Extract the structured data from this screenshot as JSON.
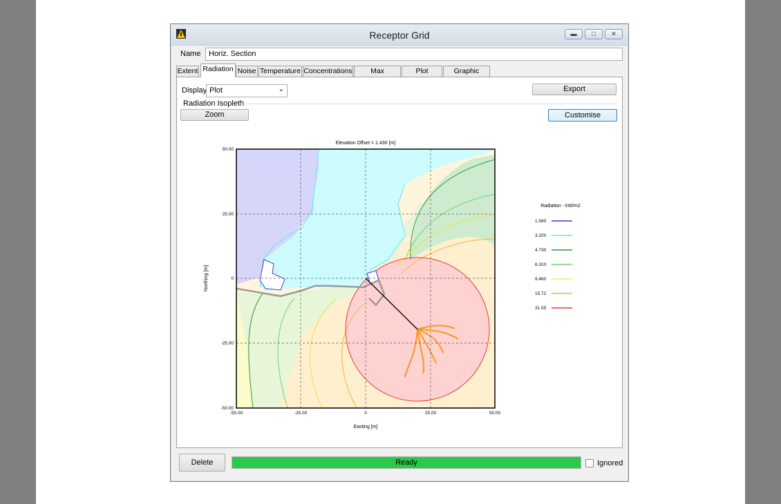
{
  "window": {
    "title": "Receptor Grid"
  },
  "name_field": {
    "label": "Name",
    "value": "Horiz. Section"
  },
  "tabs": [
    {
      "label": "Extent"
    },
    {
      "label": "Radiation",
      "active": true
    },
    {
      "label": "Noise"
    },
    {
      "label": "Temperature"
    },
    {
      "label": "Concentrations"
    },
    {
      "label": "Max Radiation"
    },
    {
      "label": "Plot Overlay"
    },
    {
      "label": "Graphic Report"
    }
  ],
  "display": {
    "label": "Display",
    "value": "Plot"
  },
  "export_label": "Export",
  "group_label": "Radiation Isopleth",
  "zoom_label": "Zoom",
  "customise_label": "Customise",
  "footer": {
    "delete_label": "Delete",
    "status": "Ready",
    "ignored_label": "Ignored",
    "progress": 1.0
  },
  "chart_data": {
    "type": "heatmap",
    "title": "Elevation Offset = 1.430 [m]",
    "xlabel": "Easting [m]",
    "ylabel": "Northing [m]",
    "xlim": [
      -50,
      50
    ],
    "ylim": [
      -50,
      50
    ],
    "xticks": [
      "-50.00",
      "-25.00",
      "0",
      "25.00",
      "50.00"
    ],
    "yticks": [
      "50.00",
      "25.00",
      "0",
      "-25.00",
      "-50.00"
    ],
    "grid": true,
    "legend_title": "Radiation - kW/m2",
    "levels": [
      {
        "value": "1.580",
        "color": "#3a3ae0"
      },
      {
        "value": "3.200",
        "color": "#5ee8ee"
      },
      {
        "value": "4.730",
        "color": "#2f9a3a"
      },
      {
        "value": "6.310",
        "color": "#6fd46f"
      },
      {
        "value": "9.460",
        "color": "#f0f05a"
      },
      {
        "value": "15.72",
        "color": "#f4b442"
      },
      {
        "value": "31.55",
        "color": "#e43c3c"
      }
    ],
    "source_line": {
      "from": [
        0,
        0
      ],
      "to": [
        20,
        -20
      ]
    }
  }
}
